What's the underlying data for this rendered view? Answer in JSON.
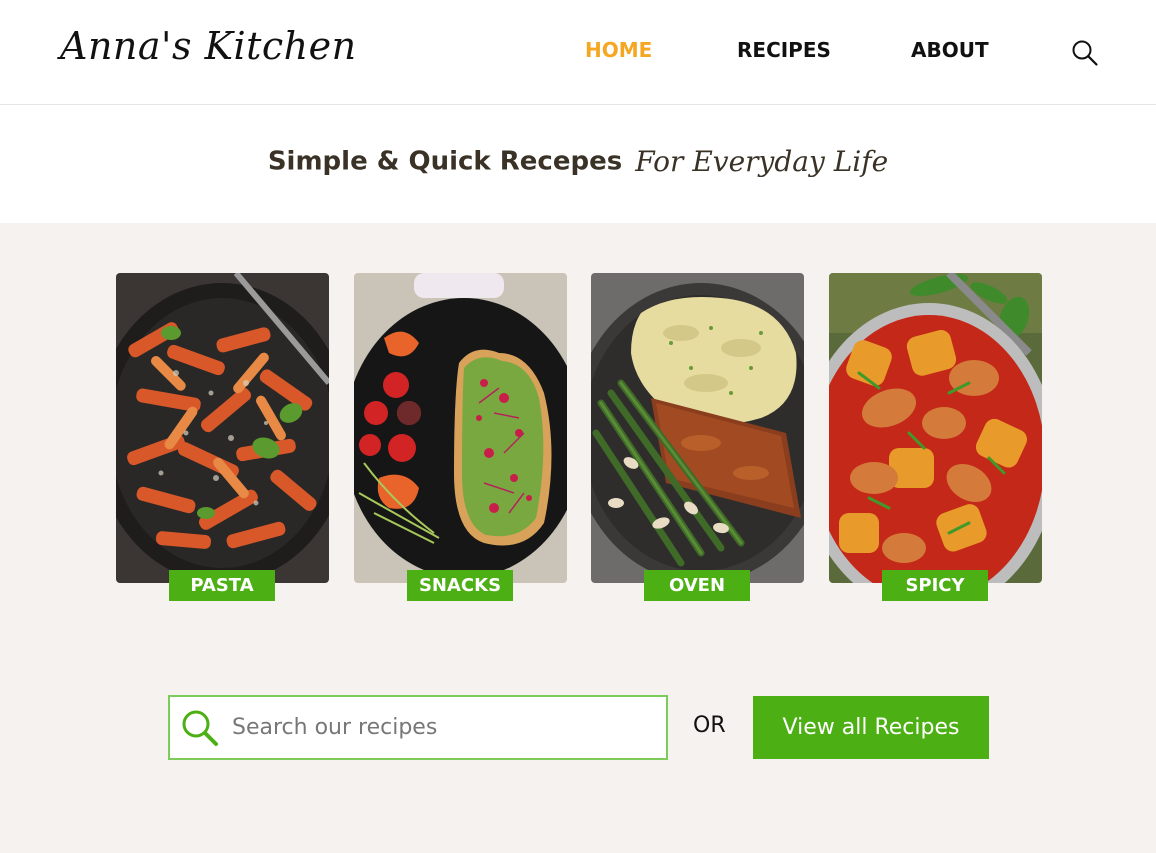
{
  "header": {
    "logo": "Anna's Kitchen",
    "nav": [
      {
        "label": "HOME",
        "active": true
      },
      {
        "label": "RECIPES",
        "active": false
      },
      {
        "label": "ABOUT",
        "active": false
      }
    ],
    "search_icon": "search-icon"
  },
  "tagline": {
    "main": "Simple & Quick Recepes",
    "script": "For Everyday Life"
  },
  "categories": [
    {
      "label": "PASTA",
      "image": "pasta-photo"
    },
    {
      "label": "SNACKS",
      "image": "snacks-photo"
    },
    {
      "label": "OVEN",
      "image": "oven-photo"
    },
    {
      "label": "SPICY",
      "image": "spicy-photo"
    }
  ],
  "search": {
    "placeholder": "Search our recipes",
    "value": "",
    "icon": "search-icon"
  },
  "or_text": "OR",
  "view_all_button": "View all Recipes",
  "colors": {
    "accent_orange": "#f5a623",
    "brand_green": "#4caf14",
    "search_border": "#7ccc5a",
    "content_bg": "#f6f2f0"
  }
}
